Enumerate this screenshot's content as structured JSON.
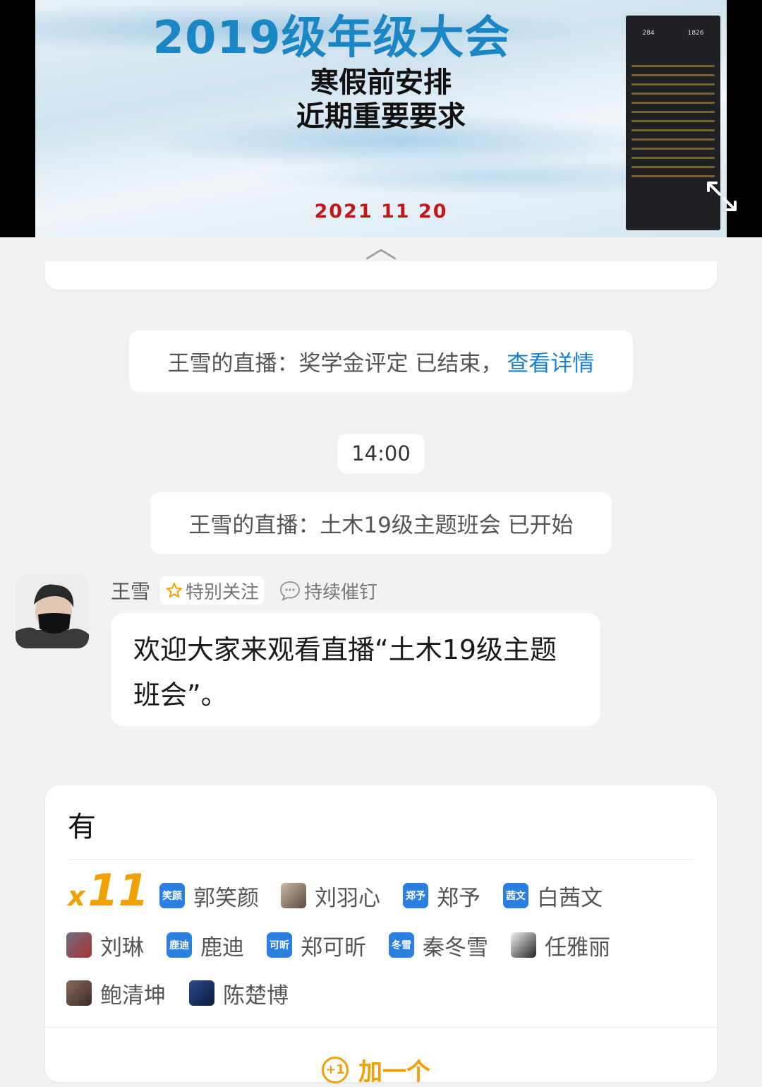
{
  "video": {
    "slide_title": "2019级年级大会",
    "slide_line1": "寒假前安排",
    "slide_line2": "近期重要要求",
    "slide_date": "2021 11 20",
    "mini_stat_1": "284",
    "mini_stat_2": "1826"
  },
  "chat": {
    "system_msg_1": "王雪的直播：奖学金评定 已结束，",
    "system_msg_1_link": "查看详情",
    "time": "14:00",
    "system_msg_2": "王雪的直播：土木19级主题班会 已开始",
    "sender_name": "王雪",
    "tag_special_follow": "特别关注",
    "tag_keep_ding": "持续催钉",
    "message": "欢迎大家来观看直播“土木19级主题班会”。"
  },
  "reaction": {
    "title": "有",
    "count_prefix": "x",
    "count": "11",
    "people": [
      {
        "name": "郭笑颜",
        "badge": "笑颜"
      },
      {
        "name": "刘羽心",
        "badge": ""
      },
      {
        "name": "郑予",
        "badge": "郑予"
      },
      {
        "name": "白茜文",
        "badge": "茜文"
      },
      {
        "name": "刘琳",
        "badge": ""
      },
      {
        "name": "鹿迪",
        "badge": "鹿迪"
      },
      {
        "name": "郑可昕",
        "badge": "可昕"
      },
      {
        "name": "秦冬雪",
        "badge": "冬雪"
      },
      {
        "name": "任雅丽",
        "badge": ""
      },
      {
        "name": "鲍清坤",
        "badge": ""
      },
      {
        "name": "陈楚博",
        "badge": ""
      }
    ],
    "plus_one_icon": "+1",
    "plus_one_label": "加一个"
  },
  "colors": {
    "link": "#1d7fcf",
    "accent": "#f0a000",
    "badge": "#2b7fe0",
    "date": "#c3161c"
  }
}
